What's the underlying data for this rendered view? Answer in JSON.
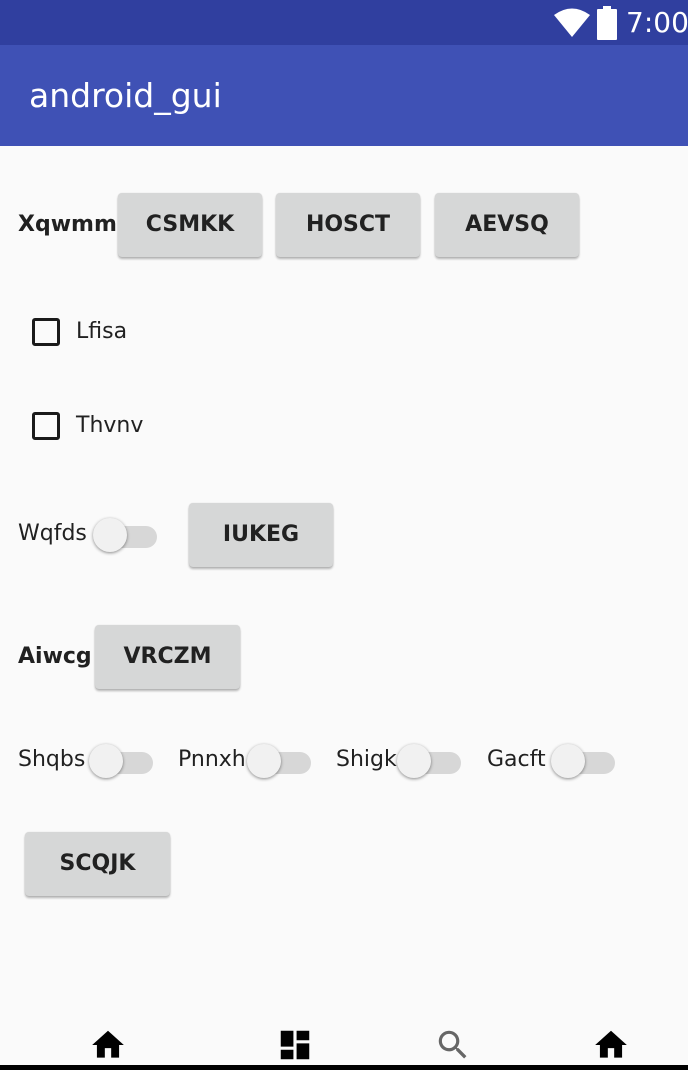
{
  "status_bar": {
    "time": "7:00",
    "wifi_icon": "wifi-icon",
    "battery_icon": "battery-icon"
  },
  "app_bar": {
    "title": "android_gui"
  },
  "row1": {
    "label": "Xqwmm",
    "buttons": [
      "CSMKK",
      "HOSCT",
      "AEVSQ"
    ]
  },
  "checkboxes": [
    {
      "label": "Lfisa",
      "checked": false
    },
    {
      "label": "Thvnv",
      "checked": false
    }
  ],
  "row_switch": {
    "label": "Wqfds",
    "on": false,
    "button": "IUKEG"
  },
  "row_aiwcg": {
    "label": "Aiwcg",
    "button": "VRCZM"
  },
  "switch_row": [
    {
      "label": "Shqbs",
      "on": false
    },
    {
      "label": "Pnnxh",
      "on": false
    },
    {
      "label": "Shigk",
      "on": false
    },
    {
      "label": "Gacft",
      "on": false
    }
  ],
  "bottom_button": "SCQJK",
  "nav_bar": {
    "icons": [
      "home-icon",
      "dashboard-icon",
      "search-icon",
      "home-icon"
    ]
  },
  "colors": {
    "status_bar": "#303f9f",
    "app_bar": "#3f51b5",
    "button": "#d6d7d7",
    "background": "#fafafa"
  }
}
